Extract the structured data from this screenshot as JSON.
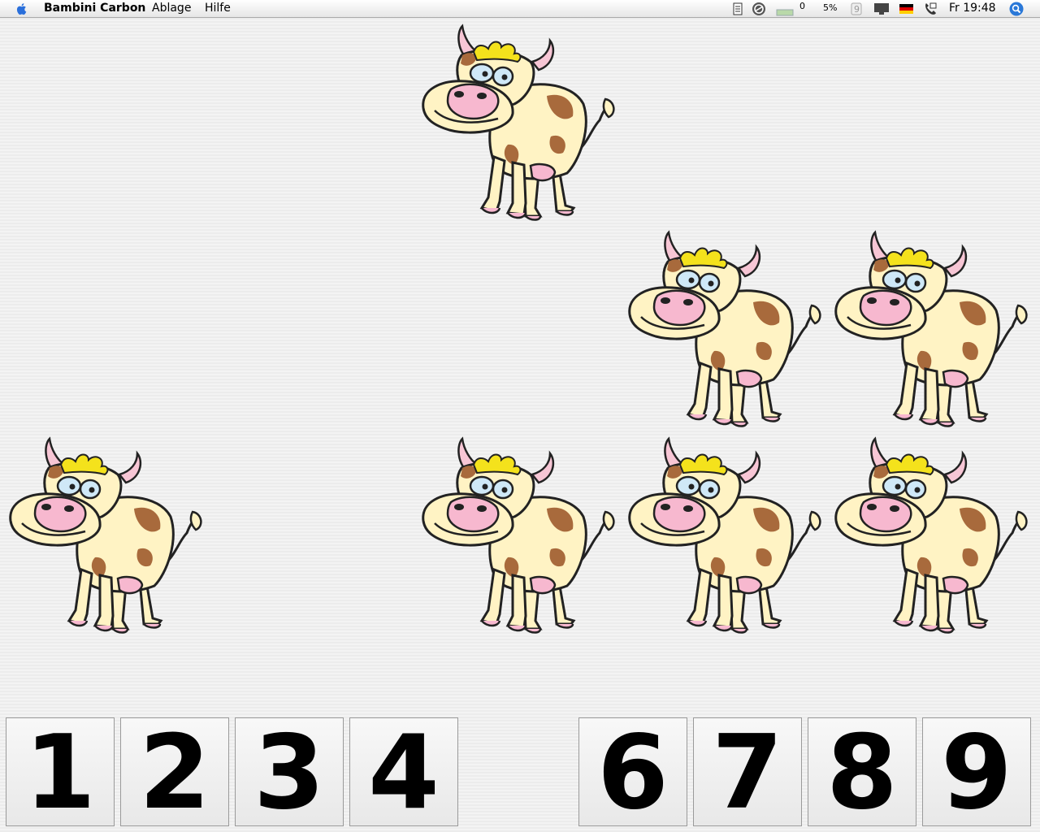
{
  "menubar": {
    "apple_icon": "apple-icon",
    "app_name": "Bambini Carbon",
    "menus": [
      "Ablage",
      "Hilfe"
    ],
    "status": {
      "battery_value": "0",
      "cpu_percent": "5%",
      "keyboard_layout": "german-flag-icon",
      "clock": "Fr 19:48",
      "spotlight_icon": "spotlight-icon"
    }
  },
  "game": {
    "cow_count": 7,
    "number_buttons": [
      "1",
      "2",
      "3",
      "4",
      "6",
      "7",
      "8",
      "9"
    ],
    "colors": {
      "cow_body": "#fff3c4",
      "cow_spots": "#a86a3c",
      "cow_nose": "#f7b8cf",
      "cow_hair": "#f4e21c"
    }
  }
}
